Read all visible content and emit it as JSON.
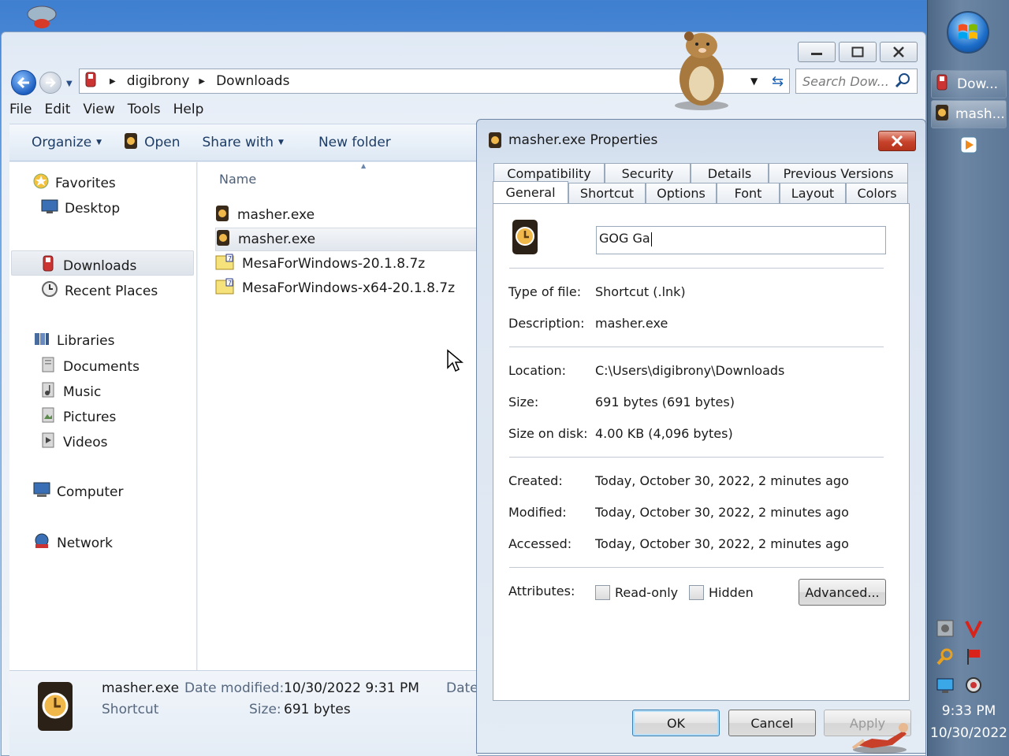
{
  "explorer": {
    "breadcrumb": [
      "digibrony",
      "Downloads"
    ],
    "search_placeholder": "Search Dow...",
    "menu": [
      "File",
      "Edit",
      "View",
      "Tools",
      "Help"
    ],
    "commands": {
      "organize": "Organize",
      "open": "Open",
      "share_with": "Share with",
      "new_folder": "New folder"
    },
    "nav": {
      "favorites": "Favorites",
      "desktop": "Desktop",
      "downloads": "Downloads",
      "recent_places": "Recent Places",
      "libraries": "Libraries",
      "documents": "Documents",
      "music": "Music",
      "pictures": "Pictures",
      "videos": "Videos",
      "computer": "Computer",
      "network": "Network"
    },
    "column_name": "Name",
    "files": [
      "masher.exe",
      "masher.exe",
      "MesaForWindows-20.1.8.7z",
      "MesaForWindows-x64-20.1.8.7z"
    ],
    "details": {
      "name": "masher.exe",
      "type": "Shortcut",
      "date_modified_label": "Date modified:",
      "date_modified": "10/30/2022 9:31 PM",
      "date_cut": "Date",
      "size_label": "Size:",
      "size": "691 bytes"
    }
  },
  "dialog": {
    "title": "masher.exe Properties",
    "tabs_row1": [
      "Compatibility",
      "Security",
      "Details",
      "Previous Versions"
    ],
    "tabs_row2": [
      "General",
      "Shortcut",
      "Options",
      "Font",
      "Layout",
      "Colors"
    ],
    "name_value": "GOG Ga",
    "fields": {
      "type_label": "Type of file:",
      "type_value": "Shortcut (.lnk)",
      "desc_label": "Description:",
      "desc_value": "masher.exe",
      "location_label": "Location:",
      "location_value": "C:\\Users\\digibrony\\Downloads",
      "size_label": "Size:",
      "size_value": "691 bytes (691 bytes)",
      "size_disk_label": "Size on disk:",
      "size_disk_value": "4.00 KB (4,096 bytes)",
      "created_label": "Created:",
      "created_value": "Today, October 30, 2022, 2 minutes ago",
      "modified_label": "Modified:",
      "modified_value": "Today, October 30, 2022, 2 minutes ago",
      "accessed_label": "Accessed:",
      "accessed_value": "Today, October 30, 2022, 2 minutes ago",
      "attributes_label": "Attributes:",
      "readonly_label": "Read-only",
      "hidden_label": "Hidden",
      "advanced_label": "Advanced..."
    },
    "buttons": {
      "ok": "OK",
      "cancel": "Cancel",
      "apply": "Apply"
    }
  },
  "taskbar": {
    "items": [
      "Dow...",
      "mash..."
    ],
    "time": "9:33 PM",
    "date": "10/30/2022"
  },
  "colors": {
    "accent": "#1d5fc1",
    "close_red": "#c7422a",
    "taskbar": "#5c7797"
  }
}
